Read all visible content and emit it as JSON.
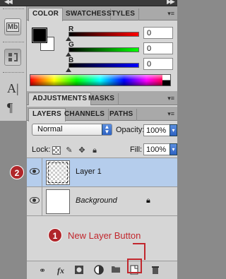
{
  "color_panel": {
    "tabs": [
      "COLOR",
      "SWATCHES",
      "STYLES"
    ],
    "sliders": [
      {
        "label": "R",
        "value": "0",
        "gradient": [
          "#000000",
          "#ff0000"
        ]
      },
      {
        "label": "G",
        "value": "0",
        "gradient": [
          "#000000",
          "#00ff00"
        ]
      },
      {
        "label": "B",
        "value": "0",
        "gradient": [
          "#000000",
          "#0000ff"
        ]
      }
    ],
    "foreground": "#000000",
    "background": "#ffffff"
  },
  "adjustments_panel": {
    "tabs": [
      "ADJUSTMENTS",
      "MASKS"
    ]
  },
  "tool_strip": {
    "items": [
      "mini-bridge-icon",
      "history-icon",
      "character-icon",
      "paragraph-icon"
    ],
    "mini_bridge_text": "Mb"
  },
  "layers_panel": {
    "tabs": [
      "LAYERS",
      "CHANNELS",
      "PATHS"
    ],
    "blend_mode": "Normal",
    "opacity_label": "Opacity:",
    "opacity_value": "100%",
    "lock_label": "Lock:",
    "fill_label": "Fill:",
    "fill_value": "100%",
    "layers": [
      {
        "name": "Layer 1",
        "selected": true
      },
      {
        "name": "Background",
        "selected": false,
        "locked": true
      }
    ]
  },
  "annotations": {
    "badge_layer": "2",
    "badge_button": "1",
    "button_label": "New Layer Button",
    "color": "#c1272d"
  },
  "bottom_toolbar": {
    "icons": [
      "link-layers-icon",
      "fx-icon",
      "add-mask-icon",
      "adjustment-layer-icon",
      "new-group-icon",
      "new-layer-icon",
      "trash-icon"
    ],
    "fx_text": "fx"
  }
}
